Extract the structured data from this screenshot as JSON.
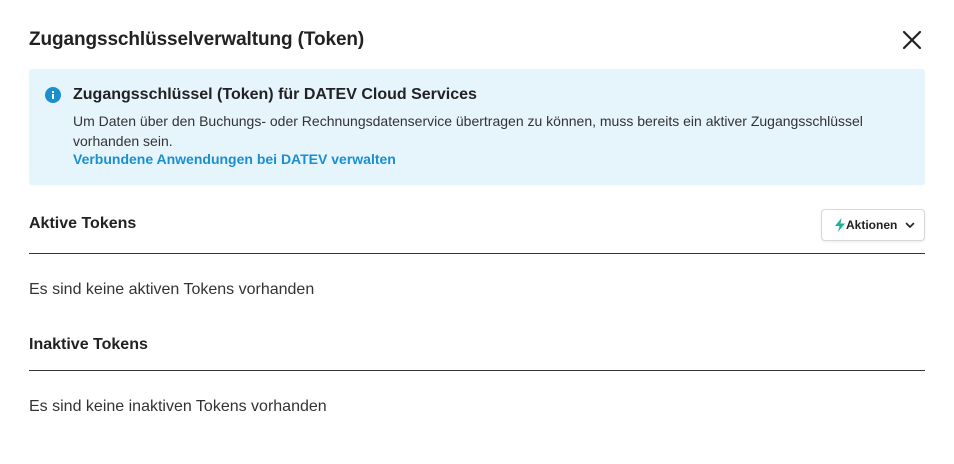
{
  "dialog": {
    "title": "Zugangsschlüsselverwaltung (Token)",
    "close_icon": "close-icon"
  },
  "info": {
    "icon": "info-icon",
    "heading": "Zugangsschlüssel (Token) für DATEV Cloud Services",
    "text": "Um Daten über den Buchungs- oder Rechnungsdatenservice übertragen zu können, muss bereits ein aktiver Zugangsschlüssel vorhanden sein.",
    "link": "Verbundene Anwendungen bei DATEV verwalten"
  },
  "active_section": {
    "title": "Aktive Tokens",
    "actions_label": "Aktionen",
    "actions_icon": "bolt-icon",
    "empty_text": "Es sind keine aktiven Tokens vorhanden"
  },
  "inactive_section": {
    "title": "Inaktive Tokens",
    "empty_text": "Es sind keine inaktiven Tokens vorhanden"
  },
  "colors": {
    "info_background": "#e6f4fc",
    "info_icon": "#1a8fd0",
    "link": "#1a8fd0",
    "bolt": "#1ab394"
  }
}
